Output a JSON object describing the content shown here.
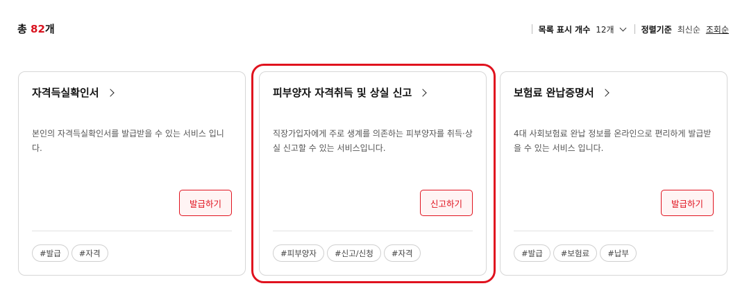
{
  "summary": {
    "prefix": "총 ",
    "count": "82",
    "suffix": "개"
  },
  "controls": {
    "list_count_label": "목록 표시 개수",
    "list_count_value": "12개",
    "sort_label": "정렬기준",
    "sort_options": [
      "최신순",
      "조회순"
    ],
    "sort_active": "조회순"
  },
  "cards": [
    {
      "title": "자격득실확인서",
      "desc": "본인의 자격득실확인서를 발급받을 수 있는 서비스 입니다.",
      "button": "발급하기",
      "tags": [
        "#발급",
        "#자격"
      ]
    },
    {
      "title": "피부양자 자격취득 및 상실 신고",
      "desc": "직장가입자에게 주로 생계를 의존하는 피부양자를 취득·상실 신고할 수 있는 서비스입니다.",
      "button": "신고하기",
      "tags": [
        "#피부양자",
        "#신고/신청",
        "#자격"
      ]
    },
    {
      "title": "보험료 완납증명서",
      "desc": "4대 사회보험료 완납 정보를 온라인으로 편리하게 발급받을 수 있는 서비스 입니다.",
      "button": "발급하기",
      "tags": [
        "#발급",
        "#보험료",
        "#납부"
      ]
    }
  ],
  "colors": {
    "accent": "#e0121e",
    "border": "#d6d6d6",
    "button_bg": "#fff4f4"
  }
}
